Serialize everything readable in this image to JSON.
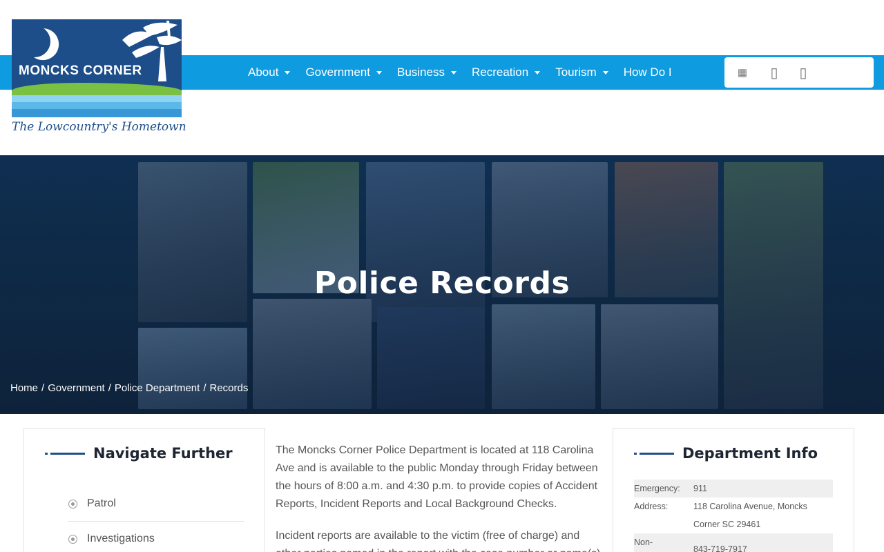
{
  "logo": {
    "name": "MONCKS CORNER",
    "tagline": "The Lowcountry's Hometown",
    "colors": {
      "navy": "#1d4e8a",
      "green": "#7ac143",
      "blue": "#3897d6"
    }
  },
  "nav": {
    "bar_color": "#0f9be0",
    "items": [
      {
        "label": "About",
        "has_dropdown": true
      },
      {
        "label": "Government",
        "has_dropdown": true
      },
      {
        "label": "Business",
        "has_dropdown": true
      },
      {
        "label": "Recreation",
        "has_dropdown": true
      },
      {
        "label": "Tourism",
        "has_dropdown": true
      },
      {
        "label": "How Do I",
        "has_dropdown": false
      }
    ],
    "tools": [
      {
        "icon": "grid-icon",
        "glyph": "▦"
      },
      {
        "icon": "box-icon-1",
        "glyph": "▯"
      },
      {
        "icon": "box-icon-2",
        "glyph": "▯"
      }
    ]
  },
  "hero": {
    "title": "Police Records",
    "breadcrumb": [
      "Home",
      "Government",
      "Police Department",
      "Records"
    ],
    "separator": "/"
  },
  "sidebar_left": {
    "heading": "Navigate Further",
    "items": [
      "Patrol",
      "Investigations"
    ]
  },
  "main": {
    "paragraphs": [
      "The Moncks Corner Police Department is located at 118 Carolina Ave  and is available to the public Monday through Friday between the hours of 8:00 a.m. and 4:30 p.m. to provide copies of Accident Reports, Incident Reports and Local Background Checks.",
      "Incident reports are available to the victim (free of charge) and other parties named in the report with the case number or name(s)"
    ]
  },
  "sidebar_right": {
    "heading": "Department Info",
    "rows": [
      {
        "label": "Emergency:",
        "value": "911"
      },
      {
        "label": "Address:",
        "value": "118 Carolina Avenue, Moncks Corner SC 29461"
      },
      {
        "label": "Non-",
        "value": "843-719-7917"
      }
    ]
  },
  "accent_color": "#1d4e8a"
}
